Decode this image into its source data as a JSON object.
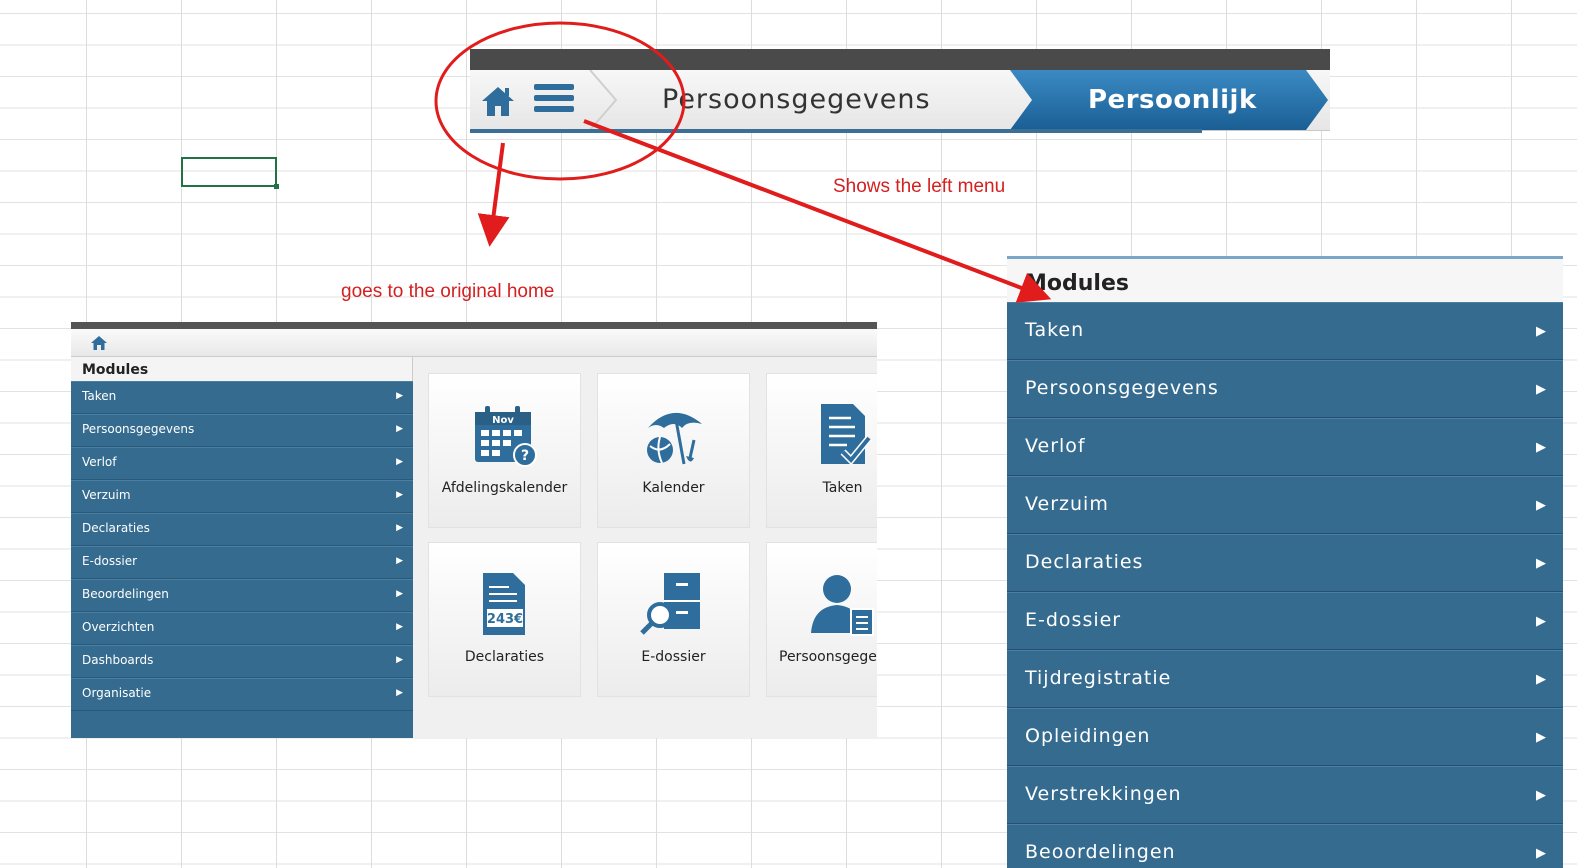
{
  "topbar": {
    "crumb": "Persoonsgegevens",
    "active_crumb": "Persoonlijk"
  },
  "annotations": {
    "menu_note": "Shows the left menu",
    "home_note": "goes to the original home"
  },
  "colors": {
    "menu_bg": "#356b8f",
    "active_crumb": "#1f6aa5",
    "annotation": "#d42020",
    "icon_blue": "#2f6e9c"
  },
  "mini": {
    "modules_title": "Modules",
    "menu_items": [
      "Taken",
      "Persoonsgegevens",
      "Verlof",
      "Verzuim",
      "Declaraties",
      "E-dossier",
      "Beoordelingen",
      "Overzichten",
      "Dashboards",
      "Organisatie"
    ],
    "tiles": [
      {
        "label": "Afdelingskalender",
        "icon": "calendar-icon",
        "month": "Nov"
      },
      {
        "label": "Kalender",
        "icon": "beach-umbrella-icon"
      },
      {
        "label": "Taken",
        "icon": "task-list-icon"
      },
      {
        "label": "Declaraties",
        "icon": "expense-document-icon",
        "amount": "243€"
      },
      {
        "label": "E-dossier",
        "icon": "file-cabinet-icon"
      },
      {
        "label": "Persoonsgege",
        "icon": "person-icon"
      }
    ]
  },
  "bigmenu": {
    "modules_title": "Modules",
    "items": [
      "Taken",
      "Persoonsgegevens",
      "Verlof",
      "Verzuim",
      "Declaraties",
      "E-dossier",
      "Tijdregistratie",
      "Opleidingen",
      "Verstrekkingen",
      "Beoordelingen"
    ]
  }
}
